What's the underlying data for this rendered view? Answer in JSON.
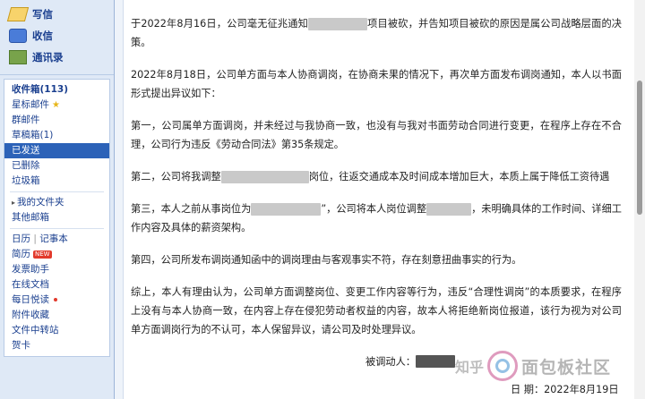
{
  "sidebar": {
    "nav": [
      {
        "label": "写信"
      },
      {
        "label": "收信"
      },
      {
        "label": "通讯录"
      }
    ],
    "folders": [
      {
        "label": "收件箱(113)"
      },
      {
        "label": "星标邮件"
      },
      {
        "label": "群邮件"
      },
      {
        "label": "草稿箱(1)"
      },
      {
        "label": "已发送"
      },
      {
        "label": "已删除"
      },
      {
        "label": "垃圾箱"
      }
    ],
    "my_folders": {
      "label": "我的文件夹"
    },
    "other_folders": {
      "label": "其他邮箱"
    },
    "calendar": {
      "label": "日历"
    },
    "notebook": {
      "label": "记事本"
    },
    "resume": {
      "label": "简历",
      "badge": "NEW"
    },
    "tools": [
      {
        "label": "发票助手"
      },
      {
        "label": "在线文档"
      },
      {
        "label": "每日悦读"
      },
      {
        "label": "附件收藏"
      },
      {
        "label": "文件中转站"
      },
      {
        "label": "贺卡"
      }
    ]
  },
  "letter": {
    "p1_a": "于2022年8月16日，公司毫无征兆通知",
    "p1_b": "项目被砍，并告知项目被砍的原因是属公司战略层面的决策。",
    "p2": "2022年8月18日，公司单方面与本人协商调岗，在协商未果的情况下，再次单方面发布调岗通知，本人以书面形式提出异议如下：",
    "p3": "第一，公司属单方面调岗，并未经过与我协商一致，也没有与我对书面劳动合同进行变更，在程序上存在不合理，公司行为违反《劳动合同法》第35条规定。",
    "p4_a": "第二，公司将我调整",
    "p4_b": "岗位，往返交通成本及时间成本增加巨大，本质上属于降低工资待遇",
    "p5_a": "第三，本人之前从事岗位为",
    "p5_b": "”，公司将本人岗位调整",
    "p5_c": "，未明确具体的工作时间、详细工作内容及具体的薪资架构。",
    "p6": "第四，公司所发布调岗通知函中的调岗理由与客观事实不符，存在刻意扭曲事实的行为。",
    "p7": "综上，本人有理由认为，公司单方面调整岗位、变更工作内容等行为，违反“合理性调岗”的本质要求，在程序上没有与本人协商一致，在内容上存在侵犯劳动者权益的内容，故本人将拒绝新岗位报道，该行为视为对公司单方面调岗行为的不认可，本人保留异议，请公司及时处理异议。",
    "signature_label": "被调动人：",
    "date_prefix": "日",
    "date_label": "期：2022年8月19日"
  },
  "watermark": {
    "zh": "知乎",
    "text": "面包板社区"
  }
}
